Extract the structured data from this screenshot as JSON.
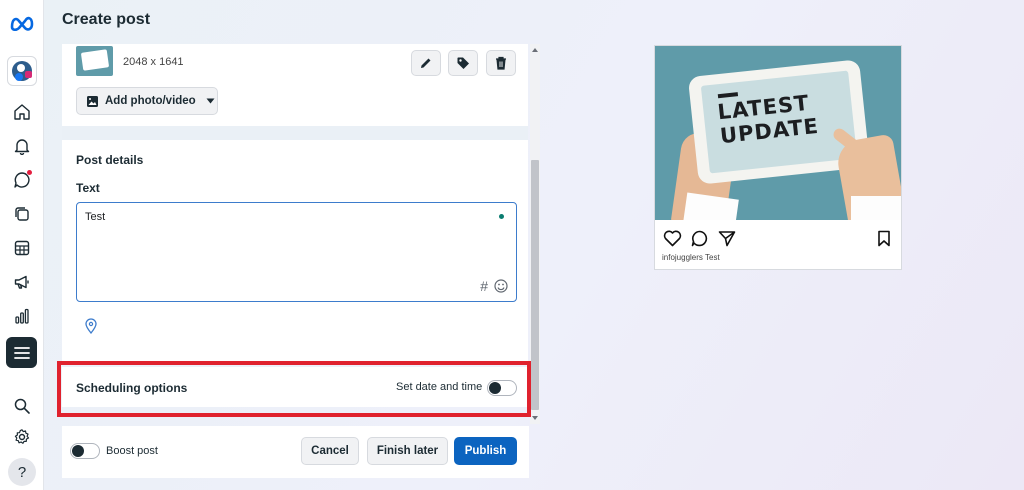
{
  "header": {
    "title": "Create post"
  },
  "sidebar": {
    "items": [
      {
        "name": "home",
        "icon": "home-icon"
      },
      {
        "name": "notifications",
        "icon": "bell-icon"
      },
      {
        "name": "inbox",
        "icon": "chat-icon",
        "badge": true
      },
      {
        "name": "content",
        "icon": "content-stack-icon"
      },
      {
        "name": "planner",
        "icon": "calendar-table-icon"
      },
      {
        "name": "ads",
        "icon": "megaphone-icon"
      },
      {
        "name": "insights",
        "icon": "bar-chart-icon"
      },
      {
        "name": "all-tools",
        "icon": "menu-icon",
        "active": true
      },
      {
        "name": "search",
        "icon": "search-icon"
      },
      {
        "name": "settings",
        "icon": "gear-icon"
      },
      {
        "name": "help",
        "icon": "question-icon"
      }
    ],
    "help_glyph": "?"
  },
  "media": {
    "dimensions": "2048 x 1641",
    "thumbnail_text": "LATEST UPDATE",
    "add_photo_label": "Add photo/video"
  },
  "post_details": {
    "section_title": "Post details",
    "text_label": "Text",
    "text_value": "Test",
    "hashtag_glyph": "#"
  },
  "scheduling": {
    "title": "Scheduling options",
    "toggle_label": "Set date and time",
    "toggle_on": false
  },
  "footer": {
    "boost_label": "Boost post",
    "boost_on": false,
    "cancel_label": "Cancel",
    "finish_later_label": "Finish later",
    "publish_label": "Publish"
  },
  "preview": {
    "image_headline": "LATEST UPDATE",
    "caption": "infojugglers Test"
  },
  "colors": {
    "accent": "#0c64c0",
    "highlight": "#e0222e",
    "focus_border": "#3d7ccc",
    "dark": "#1c2b33"
  }
}
